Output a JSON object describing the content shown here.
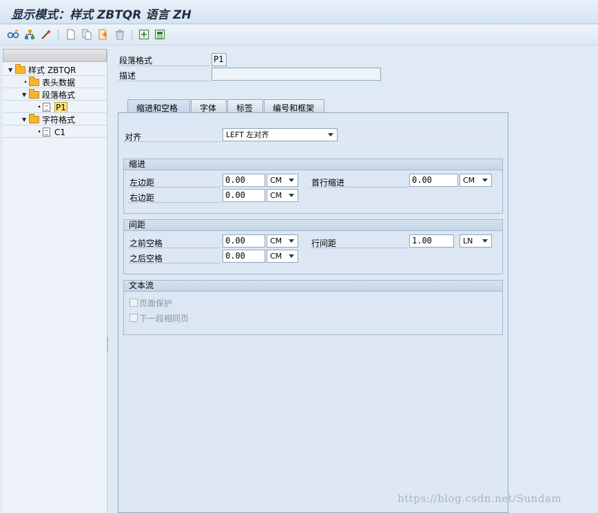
{
  "window": {
    "title": "显示模式：样式 ZBTQR 语言 ZH"
  },
  "toolbar": {
    "icons": [
      "glasses-icon",
      "hierarchy-icon",
      "magic-wand-icon",
      "new-document-icon",
      "copy-document-icon",
      "next-document-icon",
      "delete-icon",
      "add-frame-icon",
      "save-frame-icon"
    ]
  },
  "tree": {
    "root": "样式 ZBTQR",
    "header_data": "表头数据",
    "paragraph_formats": "段落格式",
    "p1": "P1",
    "char_formats": "字符格式",
    "c1": "C1"
  },
  "form": {
    "paragraph_format_label": "段落格式",
    "paragraph_format_value": "P1",
    "description_label": "描述",
    "description_value": ""
  },
  "tabs": [
    "缩进和空格",
    "字体",
    "标签",
    "编号和框架"
  ],
  "align": {
    "label": "对齐",
    "value": "LEFT 左对齐"
  },
  "indent": {
    "title": "缩进",
    "left_label": "左边距",
    "left_value": "0.00",
    "left_unit": "CM",
    "right_label": "右边距",
    "right_value": "0.00",
    "right_unit": "CM",
    "first_label": "首行缩进",
    "first_value": "0.00",
    "first_unit": "CM"
  },
  "spacing": {
    "title": "间距",
    "before_label": "之前空格",
    "before_value": "0.00",
    "before_unit": "CM",
    "after_label": "之后空格",
    "after_value": "0.00",
    "after_unit": "CM",
    "line_label": "行间距",
    "line_value": "1.00",
    "line_unit": "LN"
  },
  "textflow": {
    "title": "文本流",
    "page_protect": "页面保护",
    "next_same_page": "下一段相同页"
  },
  "watermark": "https://blog.csdn.net/Sundam",
  "colors": {
    "accent": "#f5b52b",
    "selection": "#fde27c",
    "background": "#dfeaf5"
  }
}
